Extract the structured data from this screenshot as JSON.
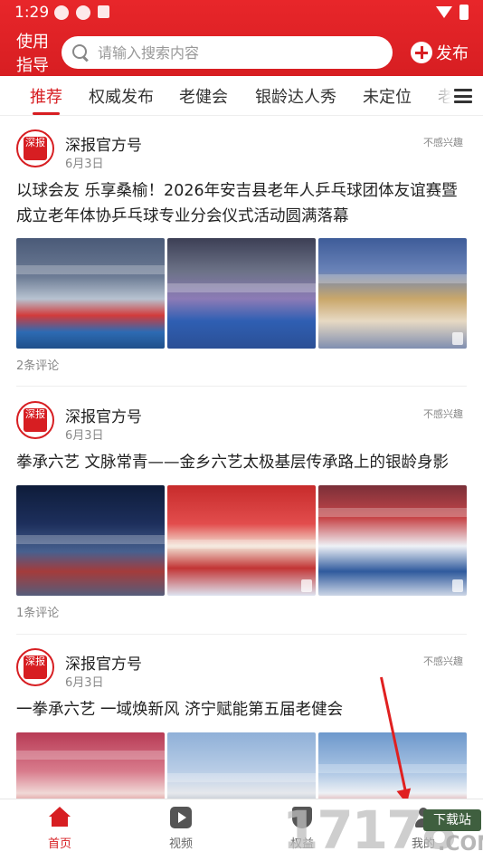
{
  "status_bar": {
    "time": "1:29"
  },
  "header": {
    "guide_label": "使用指导",
    "search_placeholder": "请输入搜索内容",
    "publish_label": "发布"
  },
  "tabs": [
    {
      "label": "推荐",
      "active": true
    },
    {
      "label": "权威发布",
      "active": false
    },
    {
      "label": "老健会",
      "active": false
    },
    {
      "label": "银龄达人秀",
      "active": false
    },
    {
      "label": "未定位",
      "active": false
    },
    {
      "label": "老",
      "active": false
    }
  ],
  "feed": [
    {
      "source": "深报官方号",
      "avatar_text": "深报",
      "date": "6月3日",
      "not_interested": "不感兴趣",
      "title": "以球会友 乐享桑榆！2026年安吉县老年人乒乓球团体友谊赛暨成立老年体协乒乓球专业分会仪式活动圆满落幕",
      "comments": "2条评论"
    },
    {
      "source": "深报官方号",
      "avatar_text": "深报",
      "date": "6月3日",
      "not_interested": "不感兴趣",
      "title": "拳承六艺 文脉常青——金乡六艺太极基层传承路上的银龄身影",
      "comments": "1条评论"
    },
    {
      "source": "深报官方号",
      "avatar_text": "深报",
      "date": "6月3日",
      "not_interested": "不感兴趣",
      "title": "一拳承六艺 一域焕新风 济宁赋能第五届老健会",
      "comments": ""
    }
  ],
  "tabbar": [
    {
      "label": "首页",
      "icon": "home-icon",
      "active": true
    },
    {
      "label": "视频",
      "icon": "video-icon",
      "active": false
    },
    {
      "label": "权益",
      "icon": "shield-icon",
      "active": false
    },
    {
      "label": "我的",
      "icon": "user-icon",
      "active": false
    }
  ],
  "watermark": {
    "number": "17178",
    "badge": "下载站",
    "domain": ".COM"
  },
  "colors": {
    "brand_red": "#d71e22",
    "text": "#222222",
    "muted": "#888888"
  }
}
